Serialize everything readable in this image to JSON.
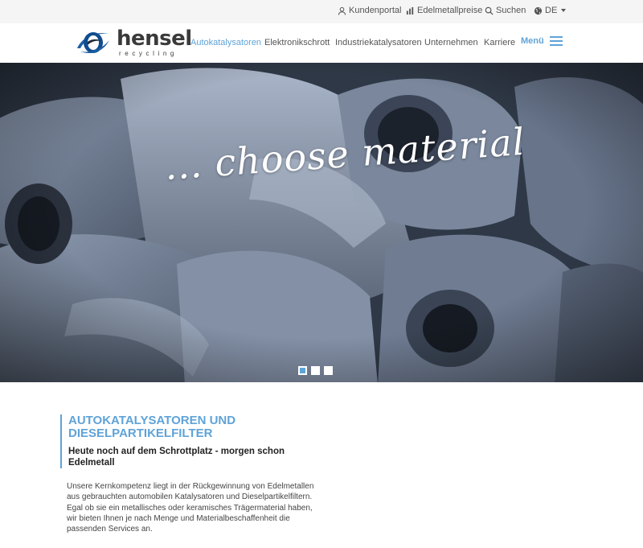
{
  "colors": {
    "accent": "#5fa3d8",
    "text": "#333333",
    "topbar_bg": "#f5f5f5"
  },
  "topbar": {
    "kundenportal": {
      "label": "Kundenportal",
      "icon": "user-icon"
    },
    "edelmetallpreise": {
      "label": "Edelmetallpreise",
      "icon": "bar-chart-icon"
    },
    "suchen": {
      "label": "Suchen",
      "icon": "search-icon"
    },
    "language": {
      "label": "DE",
      "icon": "globe-icon"
    }
  },
  "logo": {
    "word": "hensel",
    "sub": "recycling"
  },
  "nav": {
    "items": [
      {
        "label": "Autokatalysatoren",
        "active": true
      },
      {
        "label": "Elektronikschrott"
      },
      {
        "label": "Industriekatalysatoren"
      },
      {
        "label": "Unternehmen"
      },
      {
        "label": "Karriere"
      }
    ],
    "menu_label": "Menü"
  },
  "hero": {
    "caption": "... choose material",
    "slides": 3,
    "active_slide": 1
  },
  "intro": {
    "title": "Autokatalysatoren und Dieselpartikelfilter",
    "subtitle": "Heute noch auf dem Schrottplatz - morgen schon Edelmetall",
    "text": "Unsere Kernkompetenz liegt in der Rückgewinnung von Edelmetallen aus gebrauchten automobilen Katalysatoren und Dieselpartikelfiltern. Egal ob sie ein metallisches oder keramisches Trägermaterial haben, wir bieten Ihnen je nach Menge und Materialbeschaffenheit die passenden Services an."
  }
}
